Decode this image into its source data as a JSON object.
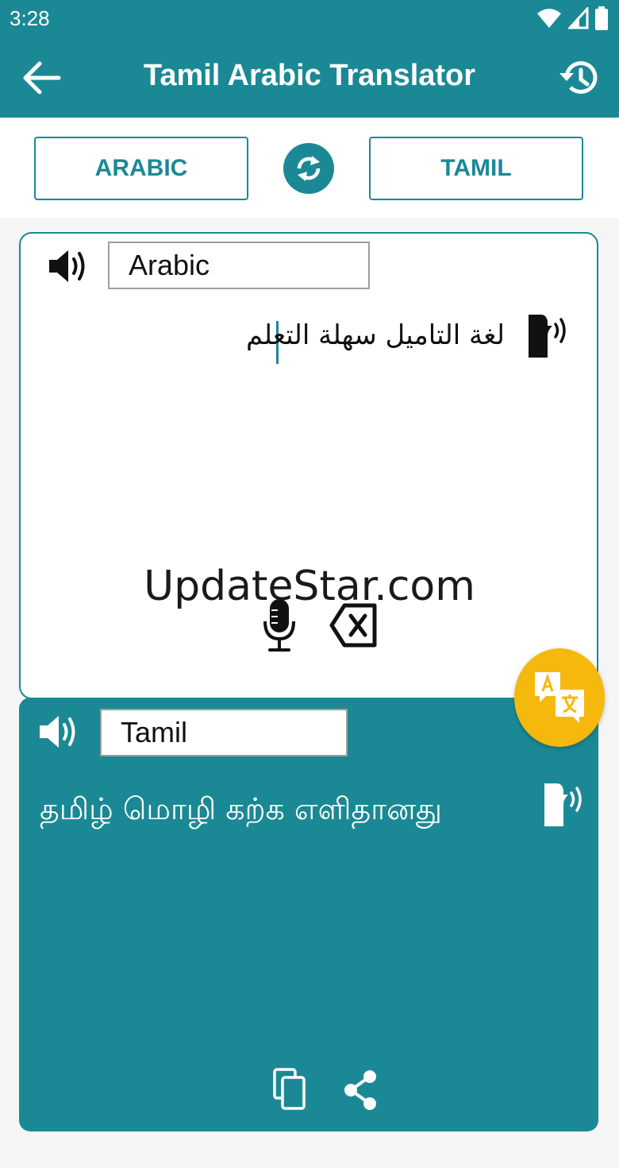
{
  "status_bar": {
    "time": "3:28"
  },
  "header": {
    "title": "Tamil Arabic Translator"
  },
  "languages": {
    "source": "ARABIC",
    "target": "TAMIL"
  },
  "input": {
    "language_label": "Arabic",
    "text": "لغة التاميل سهلة التعلم"
  },
  "output": {
    "language_label": "Tamil",
    "text": "தமிழ் மொழி கற்க எளிதானது"
  },
  "watermark": "UpdateStar.com",
  "icons": {
    "back": "arrow-left-icon",
    "history": "history-icon",
    "swap": "swap-icon",
    "speaker": "speaker-icon",
    "tts": "text-to-speech-icon",
    "mic": "microphone-icon",
    "clear": "backspace-clear-icon",
    "translate": "translate-icon",
    "copy": "copy-icon",
    "share": "share-icon"
  },
  "colors": {
    "primary": "#1b8995",
    "accent": "#f5b80c"
  }
}
